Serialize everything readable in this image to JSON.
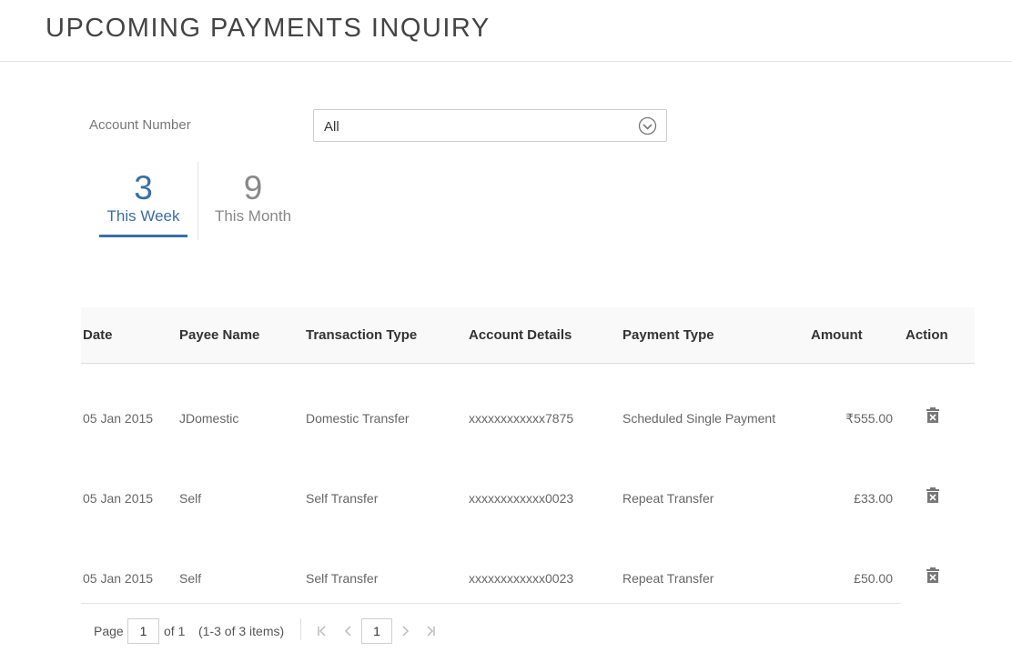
{
  "header": {
    "title": "UPCOMING PAYMENTS INQUIRY"
  },
  "filter": {
    "account_label": "Account Number",
    "account_value": "All"
  },
  "tabs": [
    {
      "count": "3",
      "label": "This Week",
      "active": true
    },
    {
      "count": "9",
      "label": "This Month",
      "active": false
    }
  ],
  "table": {
    "headers": [
      "Date",
      "Payee Name",
      "Transaction Type",
      "Account Details",
      "Payment Type",
      "Amount",
      "Action"
    ],
    "rows": [
      {
        "date": "05 Jan 2015",
        "payee": "JDomestic",
        "txn_type": "Domestic Transfer",
        "account": "xxxxxxxxxxxx7875",
        "payment_type": "Scheduled Single Payment",
        "amount": "₹555.00"
      },
      {
        "date": "05 Jan 2015",
        "payee": "Self",
        "txn_type": "Self Transfer",
        "account": "xxxxxxxxxxxx0023",
        "payment_type": "Repeat Transfer",
        "amount": "£33.00"
      },
      {
        "date": "05 Jan 2015",
        "payee": "Self",
        "txn_type": "Self Transfer",
        "account": "xxxxxxxxxxxx0023",
        "payment_type": "Repeat Transfer",
        "amount": "£50.00"
      }
    ]
  },
  "pager": {
    "page_label": "Page",
    "page_value": "1",
    "of_label": "of 1",
    "items_label": "(1-3 of 3 items)",
    "first": "K",
    "prev": "‹",
    "current": "1",
    "next": "›",
    "last": "›|"
  },
  "colors": {
    "accent": "#3a6ea5",
    "text": "#555555",
    "header_bg": "#f9f9f9"
  },
  "icons": {
    "dropdown": "chevron-circle-down-icon",
    "delete": "trash-delete-icon"
  }
}
